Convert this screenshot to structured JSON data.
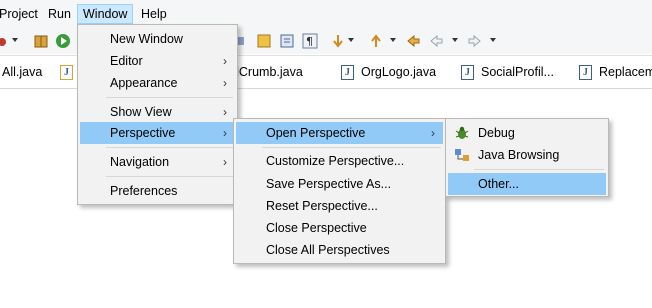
{
  "menubar": {
    "items": [
      "Project",
      "Run",
      "Window",
      "Help"
    ]
  },
  "tabs": [
    {
      "label": "All.java"
    },
    {
      "label": "adCrumb.java"
    },
    {
      "label": "OrgLogo.java"
    },
    {
      "label": "SocialProfil..."
    },
    {
      "label": "Replaceme"
    }
  ],
  "window_menu": {
    "items": [
      {
        "label": "New Window",
        "submenu": false
      },
      {
        "label": "Editor",
        "submenu": true
      },
      {
        "label": "Appearance",
        "submenu": true
      },
      {
        "label": "Show View",
        "submenu": true
      },
      {
        "label": "Perspective",
        "submenu": true
      },
      {
        "label": "Navigation",
        "submenu": true
      },
      {
        "label": "Preferences",
        "submenu": false
      }
    ]
  },
  "perspective_menu": {
    "items": [
      {
        "label": "Open Perspective",
        "submenu": true
      },
      {
        "label": "Customize Perspective..."
      },
      {
        "label": "Save Perspective As..."
      },
      {
        "label": "Reset Perspective..."
      },
      {
        "label": "Close Perspective"
      },
      {
        "label": "Close All Perspectives"
      }
    ]
  },
  "open_perspective_menu": {
    "items": [
      {
        "label": "Debug",
        "icon": "bug-icon"
      },
      {
        "label": "Java Browsing",
        "icon": "java-browsing-icon"
      },
      {
        "label": "Other..."
      }
    ]
  },
  "chevron": "›",
  "colors": {
    "menu_bg": "#f2f2f2",
    "selection": "#91c9f7",
    "menubar_active": "#cce8ff"
  }
}
